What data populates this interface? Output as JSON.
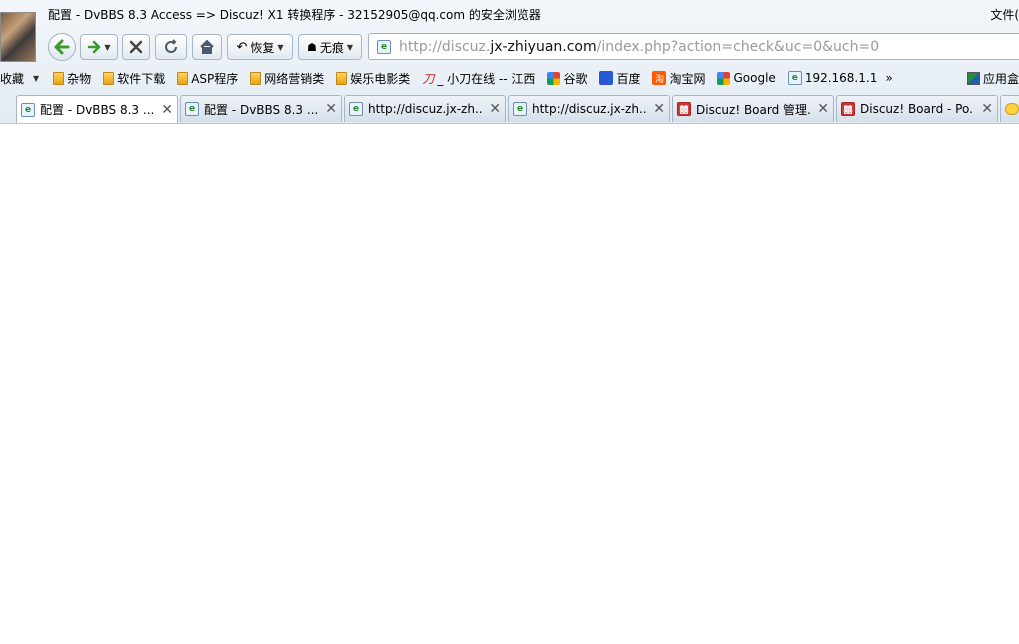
{
  "window": {
    "title": "配置 - DvBBS 8.3 Access => Discuz! X1 转换程序 - 32152905@qq.com 的安全浏览器",
    "file_menu": "文件("
  },
  "toolbar": {
    "restore_label": "恢复",
    "incognito_label": "无痕"
  },
  "address": {
    "prefix": "http://discuz.",
    "host": "jx-zhiyuan.com",
    "path": "/index.php?action=check&uc=0&uch=0"
  },
  "bookmarks": {
    "favorites_label": "收藏",
    "items": [
      {
        "label": "杂物",
        "icon": "folder-icon"
      },
      {
        "label": "软件下载",
        "icon": "folder-icon"
      },
      {
        "label": "ASP程序",
        "icon": "folder-icon"
      },
      {
        "label": "网络营销类",
        "icon": "folder-icon"
      },
      {
        "label": "娱乐电影类",
        "icon": "folder-icon"
      },
      {
        "label": "_ 小刀在线 -- 江西",
        "icon": "xiaodao-icon"
      },
      {
        "label": "谷歌",
        "icon": "google-icon"
      },
      {
        "label": "百度",
        "icon": "baidu-icon"
      },
      {
        "label": "淘宝网",
        "icon": "taobao-icon"
      },
      {
        "label": "Google",
        "icon": "google-icon"
      },
      {
        "label": "192.168.1.1",
        "icon": "page-icon"
      }
    ],
    "more": "»",
    "apps_label": "应用盒"
  },
  "tabs": [
    {
      "label": "配置 - DvBBS 8.3 ...",
      "active": true,
      "icon": "page-icon"
    },
    {
      "label": "配置 - DvBBS 8.3 ...",
      "active": false,
      "icon": "page-icon"
    },
    {
      "label": "http://discuz.jx-zh...",
      "active": false,
      "icon": "page-icon"
    },
    {
      "label": "http://discuz.jx-zh...",
      "active": false,
      "icon": "page-icon"
    },
    {
      "label": "Discuz! Board 管理...",
      "active": false,
      "icon": "discuz-icon"
    },
    {
      "label": "Discuz! Board - Po...",
      "active": false,
      "icon": "discuz-icon"
    }
  ]
}
